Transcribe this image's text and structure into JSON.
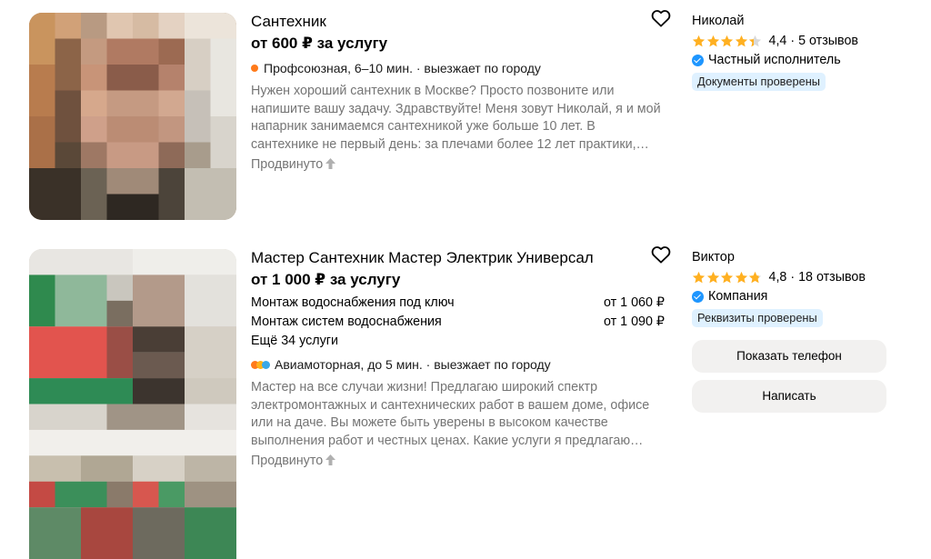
{
  "listings": [
    {
      "title": "Сантехник",
      "price": "от 600 ₽ за услугу",
      "location": "Профсоюзная, 6–10 мин. · выезжает по городу",
      "description": "Нужен хороший сантехник в Москве? Просто позвоните или напишите вашу задачу. Здравствуйте! Меня зовут Николай, я и мой напарник занимаемся сантехникой уже больше 10 лет. В сантехнике не первый день: за плечами более 12 лет практики,…",
      "promoted": "Продвинуто",
      "seller": {
        "name": "Николай",
        "rating": "4,4",
        "rating_value": 4.4,
        "reviews": "5 отзывов",
        "type": "Частный исполнитель",
        "badge": "Документы проверены"
      },
      "icons": {
        "favorite": "heart-icon",
        "promoted": "arrow-up-icon",
        "location": "metro-dot-icon"
      }
    },
    {
      "title": "Мастер Сантехник Мастер Электрик Универсал",
      "price": "от 1 000 ₽ за услугу",
      "services": [
        {
          "name": "Монтаж водоснабжения под ключ",
          "price": "от 1 060 ₽"
        },
        {
          "name": "Монтаж систем водоснабжения",
          "price": "от 1 090 ₽"
        }
      ],
      "more_services": "Ещё 34 услуги",
      "location": "Авиамоторная, до 5 мин. · выезжает по городу",
      "description": "Мастер на все случаи жизни! Предлагаю широкий спектр электромонтажных и сантехнических работ в вашем доме, офисе или на даче. Вы можете быть уверены в высоком качестве выполнения работ и честных ценах. Какие услуги я предлагаю…",
      "promoted": "Продвинуто",
      "seller": {
        "name": "Виктор",
        "rating": "4,8",
        "rating_value": 4.8,
        "reviews": "18 отзывов",
        "type": "Компания",
        "badge": "Реквизиты проверены"
      },
      "buttons": {
        "show_phone": "Показать телефон",
        "write": "Написать"
      },
      "icons": {
        "favorite": "heart-icon",
        "promoted": "arrow-up-icon",
        "location": "metro-dots-icon"
      }
    }
  ],
  "colors": {
    "star": "#ffb021",
    "star_empty": "#d9d9d9",
    "verified": "#1e96ff",
    "badge_bg": "#dff1ff",
    "metro1": "#ff7a1a",
    "metro2": "#ffb21a",
    "metro3": "#3aa8e8",
    "button_bg": "#f2f1f0",
    "secondary_text": "#757575"
  }
}
